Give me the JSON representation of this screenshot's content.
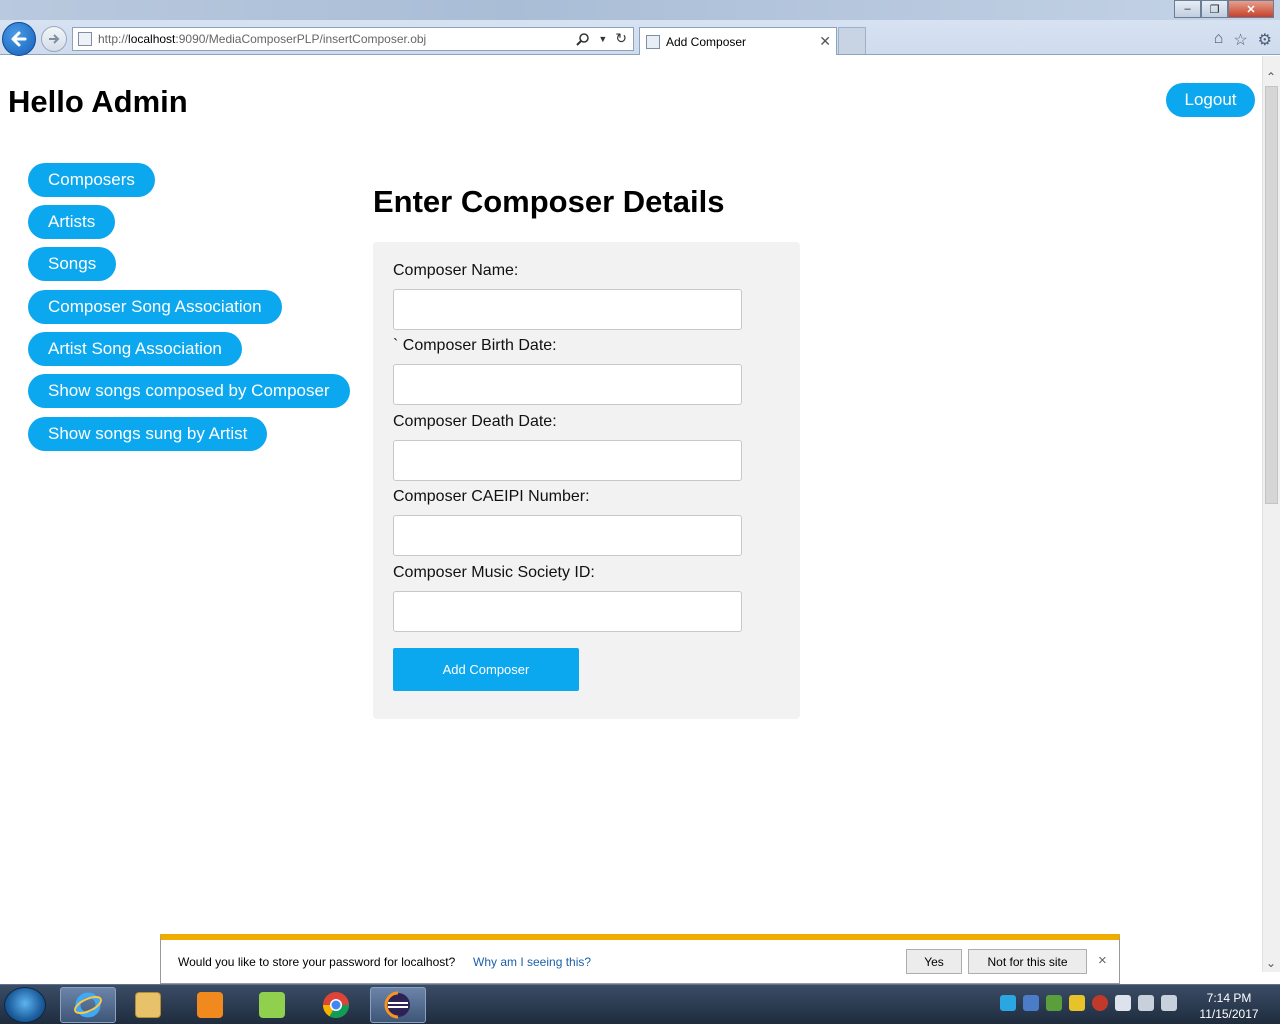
{
  "browser": {
    "url_prefix": "http://",
    "url_host": "localhost",
    "url_rest": ":9090/MediaComposerPLP/insertComposer.obj",
    "tab_title": "Add Composer"
  },
  "header": {
    "greeting": "Hello Admin",
    "logout_label": "Logout"
  },
  "sidebar": {
    "items": [
      {
        "label": "Composers"
      },
      {
        "label": "Artists"
      },
      {
        "label": "Songs"
      },
      {
        "label": "Composer Song Association"
      },
      {
        "label": "Artist Song Association"
      },
      {
        "label": "Show songs composed by Composer"
      },
      {
        "label": "Show songs sung by Artist"
      }
    ]
  },
  "form": {
    "title": "Enter Composer Details",
    "fields": [
      {
        "label": "Composer Name:",
        "value": ""
      },
      {
        "label": "` Composer Birth Date:",
        "value": ""
      },
      {
        "label": "Composer Death Date:",
        "value": ""
      },
      {
        "label": "Composer CAEIPI Number:",
        "value": ""
      },
      {
        "label": "Composer Music Society ID:",
        "value": ""
      }
    ],
    "submit_label": "Add Composer"
  },
  "password_bar": {
    "message": "Would you like to store your password for localhost?",
    "why_link": "Why am I seeing this?",
    "yes_label": "Yes",
    "no_label": "Not for this site",
    "close_icon": "×"
  },
  "taskbar": {
    "time": "7:14 PM",
    "date": "11/15/2017"
  },
  "colors": {
    "accent": "#0ba7ef",
    "form_bg": "#f2f2f2",
    "bar_highlight": "#f0ac00"
  }
}
